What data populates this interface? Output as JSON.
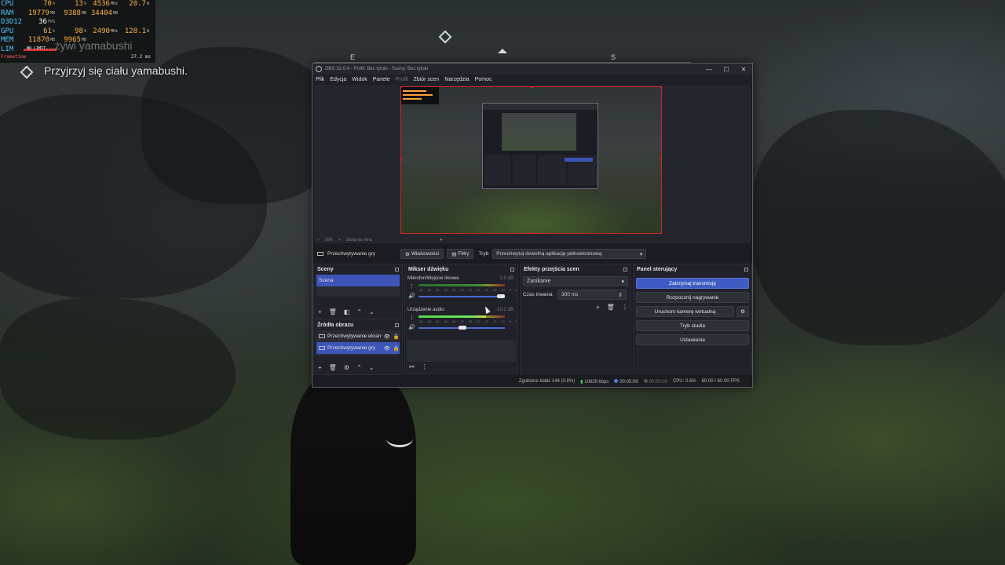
{
  "hud": {
    "rows": [
      {
        "label": "CPU",
        "v1": "70",
        "u1": "%",
        "v2": "13",
        "u2": "%",
        "v3": "4536",
        "u3": "MHz",
        "v4": "20.7",
        "u4": "W"
      },
      {
        "label": "RAM",
        "v1": "19779",
        "u1": "MB",
        "v2": "9388",
        "u2": "MB",
        "v3": "34404",
        "u3": "MB",
        "v4": "",
        "u4": ""
      },
      {
        "label": "D3D12",
        "v1": "36",
        "u1": "FPS",
        "v2": "",
        "u2": "",
        "v3": "",
        "u3": "",
        "v4": "",
        "u4": ""
      },
      {
        "label": "GPU",
        "v1": "61",
        "u1": "%",
        "v2": "98",
        "u2": "%",
        "v3": "2490",
        "u3": "MHz",
        "v4": "128.1",
        "u4": "W"
      },
      {
        "label": "MEM",
        "v1": "11870",
        "u1": "MB",
        "v2": "9965",
        "u2": "MB",
        "v3": "",
        "u3": "",
        "v4": "",
        "u4": ""
      },
      {
        "label": "LIM",
        "v1": "",
        "u1": "",
        "v2": "",
        "u2": "",
        "v3": "",
        "u3": "",
        "v4": "",
        "u4": ""
      }
    ],
    "frametime_label": "Frametime",
    "frametime_value": "27.2 ms",
    "lim_note": "NO LIMIT"
  },
  "quest": {
    "faded": "...żywi yamabushi",
    "main": "Przyjrzyj się ciału yamabushi."
  },
  "compass": {
    "letters": [
      "E",
      "S"
    ]
  },
  "obs": {
    "title": "OBS 32.0.4 - Profil: Bez tytułu - Sceny: Bez tytułu",
    "window_buttons": [
      "—",
      "☐",
      "✕"
    ],
    "menu": [
      "Plik",
      "Edycja",
      "Widok",
      "Panele",
      "Profil",
      "Zbiór scen",
      "Narzędzia",
      "Pomoc"
    ],
    "zoom": {
      "minus": "−",
      "percent": "26%",
      "plus": "+",
      "fit": "Skaluj do okna"
    },
    "source_toolbar": {
      "source": "Przechwytywanie gry",
      "properties": "Właściwości",
      "filters": "Filtry",
      "mode_label": "Tryb",
      "mode_value": "Przechwytuj dowolną aplikację pełnoekranową"
    },
    "scenes": {
      "title": "Sceny",
      "items": [
        "Scena"
      ]
    },
    "sources": {
      "title": "Źródła obrazu",
      "items": [
        "Przechwytywanie ekran",
        "Przechwytywanie gry"
      ]
    },
    "mixer": {
      "title": "Mikser dźwięku",
      "tracks": [
        {
          "name": "Mikrofon/Wejście liniowe",
          "db": "0.0 dB",
          "level": 0.0,
          "volume": 1.0
        },
        {
          "name": "Urządzenie audio",
          "db": "-10.2 dB",
          "level": 0.78,
          "volume": 0.55
        }
      ],
      "scale": [
        "-60",
        "-55",
        "-50",
        "-45",
        "-40",
        "-35",
        "-30",
        "-25",
        "-20",
        "-15",
        "-10",
        "-5",
        "0"
      ]
    },
    "transitions": {
      "title": "Efekty przejścia scen",
      "type": "Zanikanie",
      "duration_label": "Czas trwania",
      "duration_value": "300 ms"
    },
    "controls": {
      "title": "Panel sterujący",
      "stop_stream": "Zatrzymaj transmisję",
      "start_recording": "Rozpocznij nagrywanie",
      "virtual_cam": "Uruchom kamerę wirtualną",
      "studio_mode": "Tryb studia",
      "settings": "Ustawienia"
    },
    "status": {
      "dropped": "Zgubione klatki 144 (0.8%)",
      "bitrate": "10629 kbps",
      "stream_time": "00:05:09",
      "rec_time": "00:00:00",
      "cpu": "CPU: 0.6%",
      "fps": "60.00 / 60.00 FPS"
    }
  },
  "colors": {
    "accent": "#3f5cc4",
    "selection_border": "#d52222"
  }
}
